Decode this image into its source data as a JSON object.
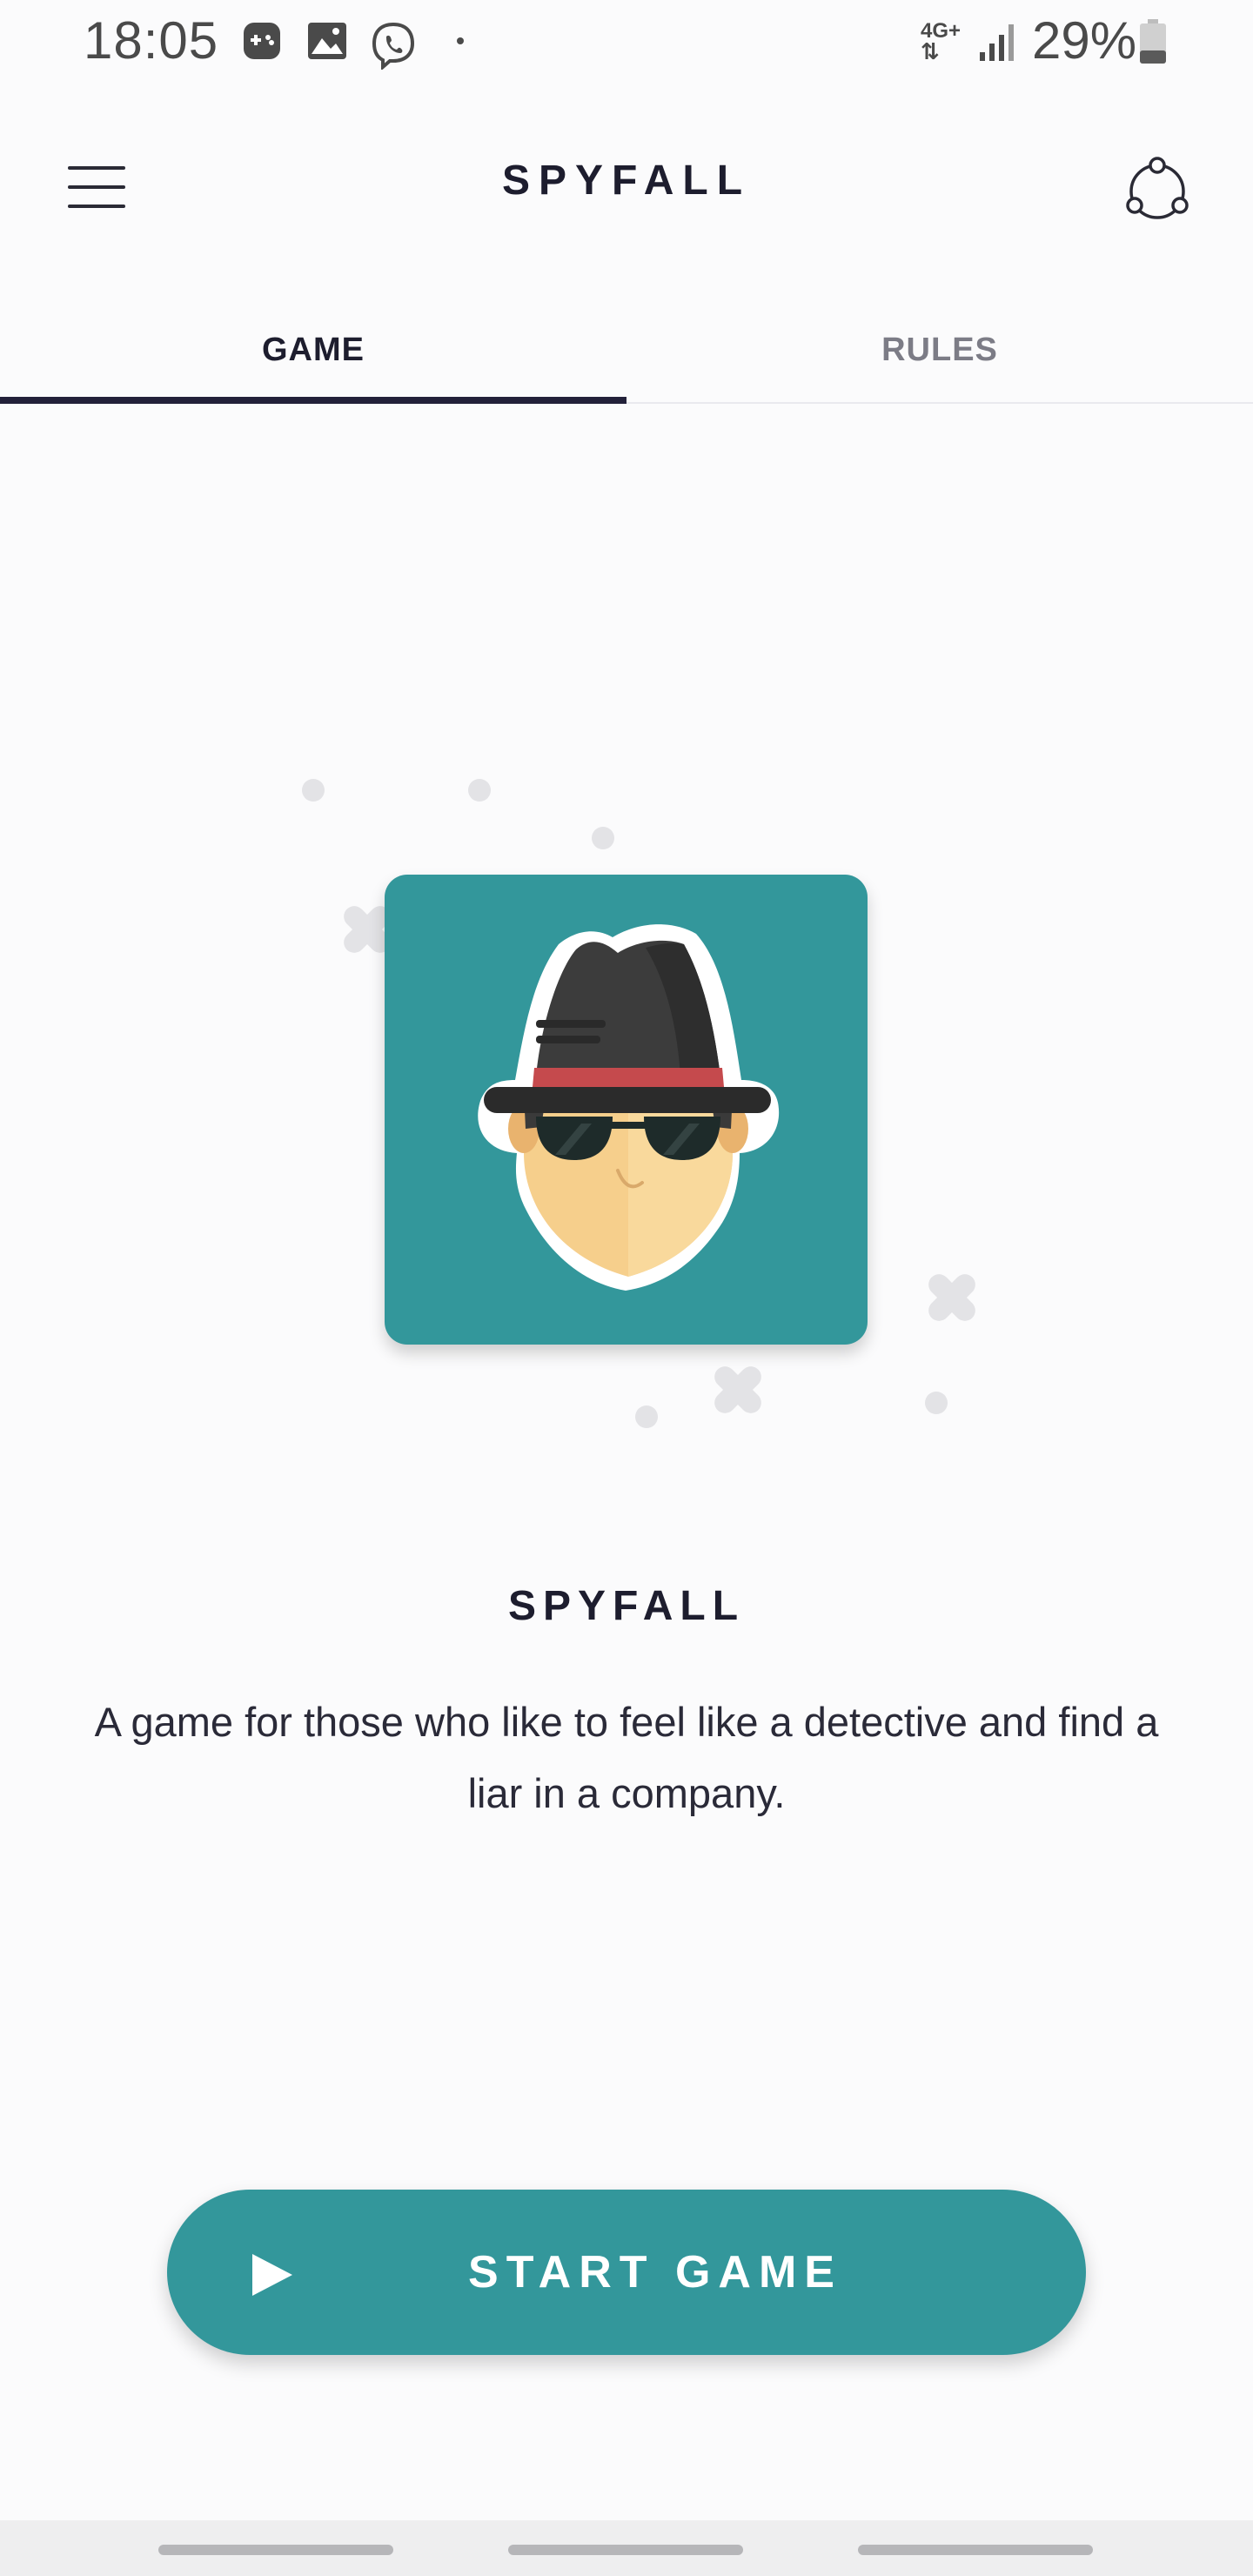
{
  "status_bar": {
    "time": "18:05",
    "network": "4G+",
    "battery": "29%",
    "icons": [
      "game-notification-icon",
      "gallery-notification-icon",
      "viber-notification-icon",
      "more-dot-icon",
      "signal-icon",
      "battery-icon"
    ]
  },
  "app_bar": {
    "title": "SPYFALL",
    "menu_icon": "hamburger-menu-icon",
    "share_icon": "share-icon"
  },
  "tabs": [
    {
      "label": "GAME",
      "selected": true
    },
    {
      "label": "RULES",
      "selected": false
    }
  ],
  "illustration": {
    "icon": "spy-icon",
    "card_color": "#33979b"
  },
  "content": {
    "headline": "SPYFALL",
    "description": "A game for those who like to feel like a detective and find a liar in a company."
  },
  "start_button": {
    "label": "START GAME",
    "icon": "play-icon",
    "color": "#33979b"
  },
  "colors": {
    "accent": "#33979b",
    "tab_indicator": "#23213a",
    "text_primary": "#1d1d2e",
    "text_secondary": "#7c7c86"
  }
}
